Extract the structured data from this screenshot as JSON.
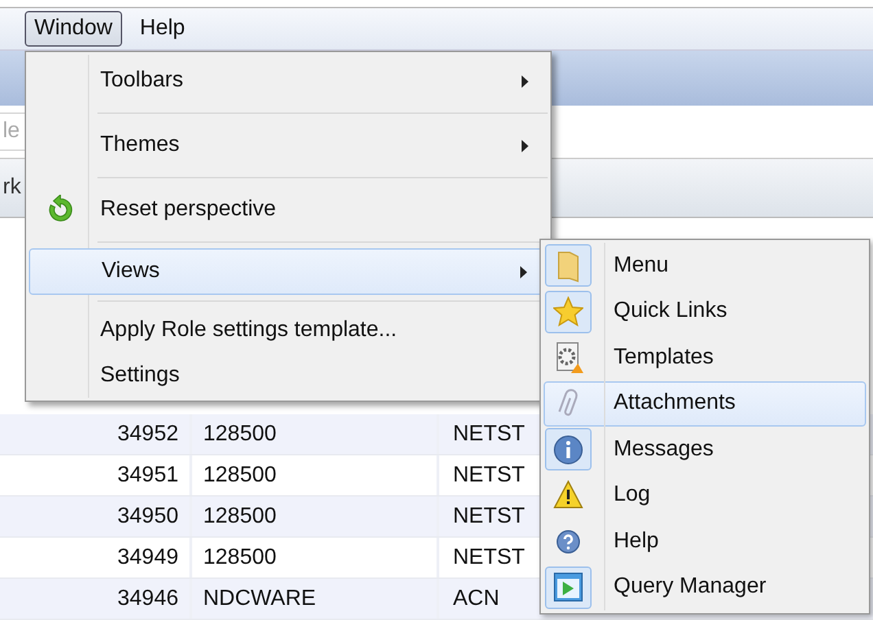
{
  "menubar": [
    {
      "label": "Window",
      "selected": true
    },
    {
      "label": "Help",
      "selected": false
    }
  ],
  "background": {
    "field_placeholder": "le",
    "tab_label": "rk"
  },
  "table": {
    "rows": [
      {
        "cells": [
          "34952",
          "128500",
          "NETST"
        ]
      },
      {
        "cells": [
          "34951",
          "128500",
          "NETST"
        ]
      },
      {
        "cells": [
          "34950",
          "128500",
          "NETST"
        ]
      },
      {
        "cells": [
          "34949",
          "128500",
          "NETST"
        ]
      },
      {
        "cells": [
          "34946",
          "NDCWARE",
          "ACN"
        ]
      }
    ]
  },
  "window_menu": {
    "groups": [
      [
        {
          "label": "Toolbars",
          "submenu": true,
          "selected": false,
          "kind": "plain"
        }
      ],
      [
        {
          "label": "Themes",
          "submenu": true,
          "selected": false,
          "kind": "plain"
        }
      ],
      [
        {
          "label": "Reset perspective",
          "submenu": false,
          "selected": false,
          "kind": "refresh"
        }
      ],
      [
        {
          "label": "Views",
          "submenu": true,
          "selected": true,
          "kind": "plain"
        }
      ],
      [
        {
          "label": "Apply Role settings template...",
          "submenu": false,
          "selected": false,
          "kind": "plain"
        },
        {
          "label": "Settings",
          "submenu": false,
          "selected": false,
          "kind": "plain"
        }
      ]
    ]
  },
  "views_submenu": {
    "items": [
      {
        "label": "Menu",
        "kind": "folder",
        "checked": true,
        "selected": false
      },
      {
        "label": "Quick Links",
        "kind": "star",
        "checked": true,
        "selected": false
      },
      {
        "label": "Templates",
        "kind": "template",
        "checked": false,
        "selected": false
      },
      {
        "label": "Attachments",
        "kind": "paperclip",
        "checked": false,
        "selected": true
      },
      {
        "label": "Messages",
        "kind": "info",
        "checked": true,
        "selected": false
      },
      {
        "label": "Log",
        "kind": "warning",
        "checked": false,
        "selected": false
      },
      {
        "label": "Help",
        "kind": "help",
        "checked": false,
        "selected": false
      },
      {
        "label": "Query Manager",
        "kind": "query",
        "checked": true,
        "selected": false
      }
    ]
  }
}
